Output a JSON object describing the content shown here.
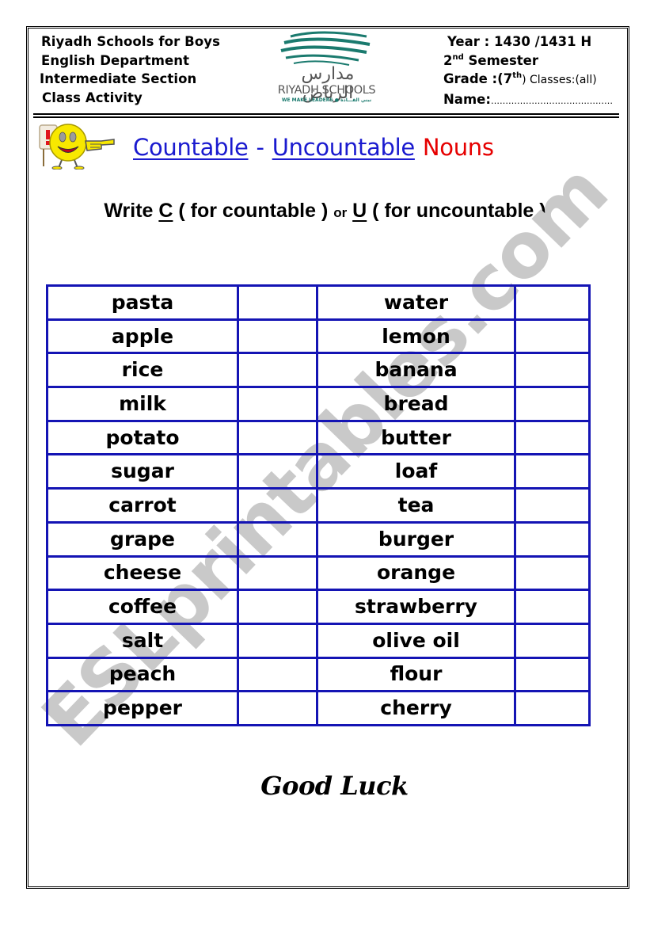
{
  "header": {
    "left_lines": [
      "Riyadh Schools for Boys",
      "English Department",
      "Intermediate Section",
      "Class Activity"
    ],
    "right": {
      "year": "Year : 1430 /1431 H",
      "semester_num": "2",
      "semester_sup": "nd",
      "semester_label": " Semester",
      "grade_label": "Grade :(7",
      "grade_sup": "th",
      "grade_close": ")",
      "classes": " Classes:(all)",
      "name_label": "Name:",
      "name_dots": "……………………………………"
    },
    "logo": {
      "arabic": "مدارس الرياض",
      "english": "RIYADH SCHOOLS",
      "tagline": "WE MAKE LEADERS ● نبني القـــادة"
    }
  },
  "title": {
    "countable": "Countable",
    "dash": "-",
    "uncountable": "Uncountable",
    "nouns": "Nouns"
  },
  "instruction": {
    "write": "Write ",
    "c_letter": "C",
    "for_countable": " ( for countable ) ",
    "or": "or",
    "u_letter": "U",
    "for_uncountable": " ( for uncountable )"
  },
  "table": {
    "rows": [
      {
        "left": "pasta",
        "right": "water"
      },
      {
        "left": "apple",
        "right": "lemon"
      },
      {
        "left": "rice",
        "right": "banana"
      },
      {
        "left": "milk",
        "right": "bread"
      },
      {
        "left": "potato",
        "right": "butter"
      },
      {
        "left": "sugar",
        "right": "loaf"
      },
      {
        "left": "carrot",
        "right": "tea"
      },
      {
        "left": "grape",
        "right": "burger"
      },
      {
        "left": "cheese",
        "right": "orange"
      },
      {
        "left": "coffee",
        "right": "strawberry"
      },
      {
        "left": "salt",
        "right": "olive oil"
      },
      {
        "left": "peach",
        "right": "flour"
      },
      {
        "left": "pepper",
        "right": "cherry"
      }
    ]
  },
  "footer": {
    "good_luck": "Good Luck"
  },
  "watermark": "ESLprintables.com",
  "colors": {
    "title_blue": "#1a1acf",
    "title_red": "#e60000",
    "table_border": "#1414b4",
    "watermark": "#c9c9c9",
    "logo_teal": "#1a7a6e"
  }
}
